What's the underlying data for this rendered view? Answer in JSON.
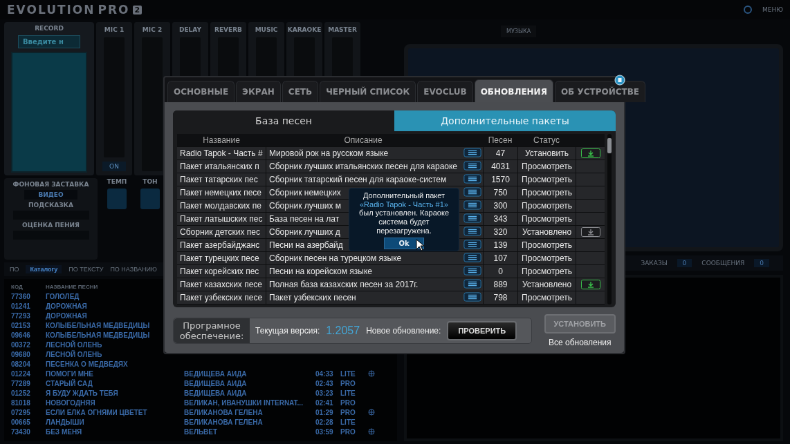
{
  "app_bar": {
    "logo": "EVOLUTION",
    "logo_suffix": "PRO",
    "logo_badge": "2",
    "menu": "МЕНЮ"
  },
  "mixer": {
    "record": {
      "label": "RECORD",
      "field_value": "Введите н"
    },
    "channels": [
      {
        "label": "MIC 1",
        "switch": "ON"
      },
      {
        "label": "MIC 2"
      },
      {
        "label": "DELAY"
      },
      {
        "label": "REVERB"
      },
      {
        "label": "MUSIC"
      },
      {
        "label": "KARAOKE"
      },
      {
        "label": "MASTER"
      }
    ]
  },
  "controls": {
    "background_label": "ФОНОВАЯ ЗАСТАВКА",
    "background_value": "ВИДЕО",
    "hint_label": "ПОДСКАЗКА",
    "rating_label": "ОЦЕНКА ПЕНИЯ",
    "tempo_label": "ТЕМП",
    "tone_label": "ТОН"
  },
  "search_tabs": [
    {
      "label": "ПО",
      "selected": false
    },
    {
      "label": "Каталогу",
      "selected": true
    },
    {
      "label": "ПО ТЕКСТУ",
      "selected": false
    },
    {
      "label": "ПО НАЗВАНИЮ",
      "selected": false
    }
  ],
  "song_list": {
    "columns": [
      "КОД",
      "НАЗВАНИЕ ПЕСНИ"
    ],
    "rows": [
      {
        "code": "77360",
        "title": "ГОЛОЛЕД"
      },
      {
        "code": "01241",
        "title": "ДОРОЖНАЯ"
      },
      {
        "code": "77293",
        "title": "ДОРОЖНАЯ"
      },
      {
        "code": "02153",
        "title": "КОЛЫБЕЛЬНАЯ МЕДВЕДИЦЫ"
      },
      {
        "code": "09646",
        "title": "КОЛЫБЕЛЬНАЯ МЕДВЕДИЦЫ"
      },
      {
        "code": "00372",
        "title": "ЛЕСНОЙ ОЛЕНЬ"
      },
      {
        "code": "09680",
        "title": "ЛЕСНОЙ ОЛЕНЬ"
      },
      {
        "code": "08204",
        "title": "ПЕСЕНКА О МЕДВЕДЯХ"
      },
      {
        "code": "01224",
        "title": "ПОМОГИ МНЕ",
        "artist": "ВЕДИЩЕВА АИДА",
        "duration": "04:33",
        "edition": "LITE",
        "has_icon": true
      },
      {
        "code": "77289",
        "title": "СТАРЫЙ САД",
        "artist": "ВЕДИЩЕВА АИДА",
        "duration": "02:43",
        "edition": "PRO",
        "has_icon": false
      },
      {
        "code": "01252",
        "title": "Я БУДУ ЖДАТЬ ТЕБЯ",
        "artist": "ВЕДИЩЕВА АИДА",
        "duration": "03:23",
        "edition": "LITE",
        "has_icon": false
      },
      {
        "code": "81018",
        "title": "НОВОГОДНЯЯ",
        "artist": "ВЕЛИКАН, ИВАНУШКИ INTERNAT...",
        "duration": "02:41",
        "edition": "PRO",
        "has_icon": false
      },
      {
        "code": "07295",
        "title": "ЕСЛИ ЕЛКА ОГНЯМИ ЦВЕТЕТ",
        "artist": "ВЕЛИКАНОВА ГЕЛЕНА",
        "duration": "01:29",
        "edition": "PRO",
        "has_icon": true
      },
      {
        "code": "00665",
        "title": "ЛАНДЫШИ",
        "artist": "ВЕЛИКАНОВА ГЕЛЕНА",
        "duration": "02:28",
        "edition": "LITE",
        "has_icon": false
      },
      {
        "code": "73430",
        "title": "БЕЗ МЕНЯ",
        "artist": "ВЕЛЬВЕТ",
        "duration": "03:59",
        "edition": "PRO",
        "has_icon": true
      }
    ]
  },
  "right_panel": {
    "music_button": "МУЗЫКА",
    "orders_label": "ЗАКАЗЫ",
    "orders_count": "0",
    "messages_label": "СООБЩЕНИЯ",
    "messages_count": "0"
  },
  "dialog": {
    "tabs": [
      {
        "label": "ОСНОВНЫЕ",
        "selected": false
      },
      {
        "label": "ЭКРАН",
        "selected": false
      },
      {
        "label": "СЕТЬ",
        "selected": false
      },
      {
        "label": "ЧЕРНЫЙ СПИСОК",
        "selected": false
      },
      {
        "label": "EVOCLUB",
        "selected": false
      },
      {
        "label": "ОБНОВЛЕНИЯ",
        "selected": true
      },
      {
        "label": "ОБ УСТРОЙСТВЕ",
        "selected": false
      }
    ],
    "sub_tabs": [
      {
        "label": "База песен",
        "selected": false
      },
      {
        "label": "Дополнительные пакеты",
        "selected": true
      }
    ],
    "table": {
      "columns": [
        "Название",
        "Описание",
        "Песен",
        "Статус"
      ],
      "rows": [
        {
          "name": "Radio Tapok - Часть #",
          "description": "Мировой рок на русском языке",
          "songs": "47",
          "status": "Установить",
          "download": {
            "active": true
          }
        },
        {
          "name": "Пакет итальянских п",
          "description": "Сборник лучших итальянских песен для караоке",
          "songs": "4031",
          "status": "Просмотреть"
        },
        {
          "name": "Пакет татарских пес",
          "description": "Сборник татарский песен для караоке-систем",
          "songs": "1570",
          "status": "Просмотреть"
        },
        {
          "name": "Пакет немецких песе",
          "description": "Сборник немецких",
          "songs": "750",
          "status": "Просмотреть"
        },
        {
          "name": "Пакет молдавских пе",
          "description": "Сборник лучших м",
          "songs": "300",
          "status": "Просмотреть"
        },
        {
          "name": "Пакет латышских пес",
          "description": "База песен на лат",
          "songs": "343",
          "status": "Просмотреть"
        },
        {
          "name": "Сборник детских пес",
          "description": "Сборник лучших д",
          "songs": "320",
          "status": "Установлено",
          "download": {
            "active": false
          }
        },
        {
          "name": "Пакет азербайджанс",
          "description": "Песни на азербайд",
          "songs": "139",
          "status": "Просмотреть"
        },
        {
          "name": "Пакет турецких песе",
          "description": "Сборник песен на турецком языке",
          "songs": "107",
          "status": "Просмотреть"
        },
        {
          "name": "Пакет корейских пес",
          "description": "Песни на корейском языке",
          "songs": "0",
          "status": "Просмотреть"
        },
        {
          "name": "Пакет казахских песе",
          "description": "Полная база казахских песен за 2017г.",
          "songs": "889",
          "status": "Установлено",
          "download": {
            "active": true
          }
        },
        {
          "name": "Пакет узбекских песе",
          "description": "Пакет узбекских песен",
          "songs": "798",
          "status": "Просмотреть"
        }
      ]
    },
    "software": {
      "label": "Програмное обеспечение:",
      "current_label": "Текущая версия:",
      "current_version": "1.2057",
      "new_label": "Новое обновление:",
      "check_button": "ПРОВЕРИТЬ",
      "install_button": "УСТАНОВИТЬ",
      "install_disabled": true,
      "install_caption": "Все обновления"
    },
    "message_box": {
      "message": [
        {
          "text": "Дополнительный пакет ",
          "highlight": false
        },
        {
          "text": "«Radio Tapok - Часть #1»",
          "highlight": true
        },
        {
          "text": " был установлен. Караоке система будет перезагружена.",
          "highlight": false
        }
      ],
      "ok_button": "Ok"
    }
  }
}
